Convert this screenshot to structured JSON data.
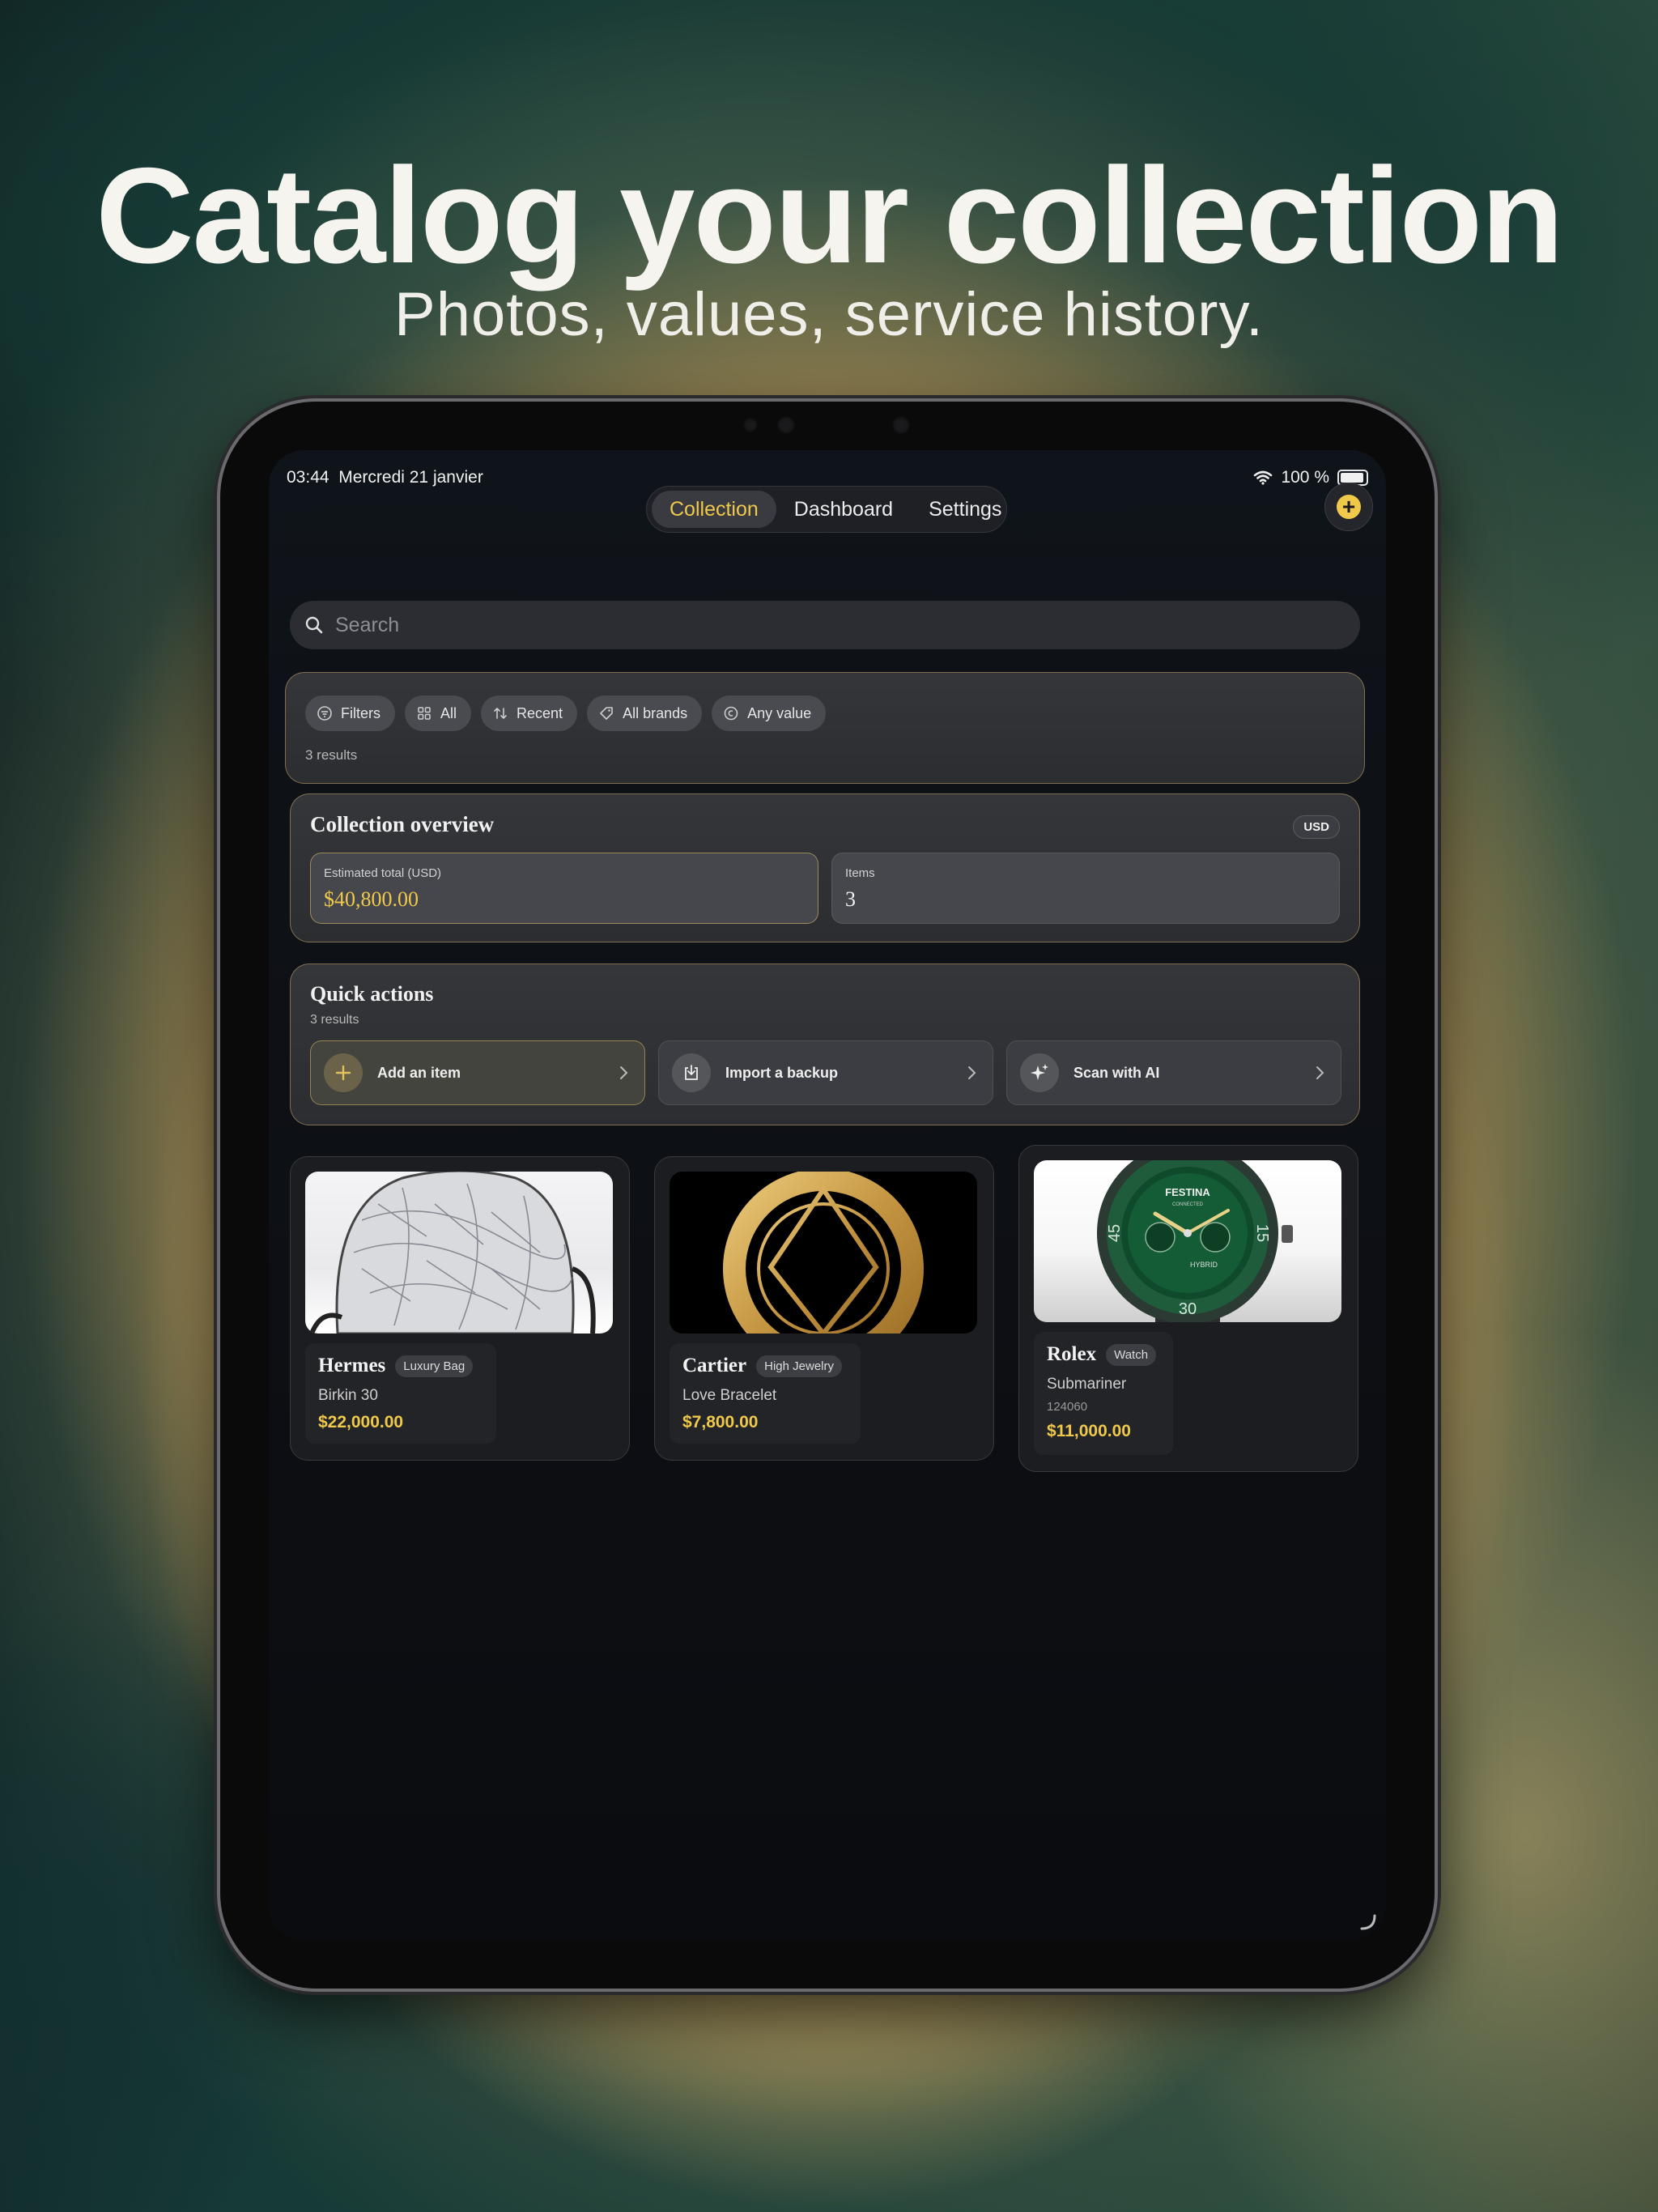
{
  "promo": {
    "headline": "Catalog your collection",
    "subhead": "Photos, values, service history."
  },
  "status_bar": {
    "time": "03:44",
    "date": "Mercredi 21 janvier",
    "battery": "100 %"
  },
  "nav": {
    "tabs": [
      {
        "label": "Collection",
        "active": true
      },
      {
        "label": "Dashboard",
        "active": false
      },
      {
        "label": "Settings",
        "active": false
      }
    ],
    "add_icon": "plus-icon"
  },
  "search": {
    "placeholder": "Search"
  },
  "filters": {
    "chips": [
      {
        "label": "Filters",
        "icon": "filter-icon"
      },
      {
        "label": "All",
        "icon": "grid-icon"
      },
      {
        "label": "Recent",
        "icon": "sort-icon"
      },
      {
        "label": "All brands",
        "icon": "tag-icon"
      },
      {
        "label": "Any value",
        "icon": "coin-icon"
      }
    ],
    "results": "3 results"
  },
  "overview": {
    "title": "Collection overview",
    "currency_badge": "USD",
    "total_label": "Estimated total (USD)",
    "total_value": "$40,800.00",
    "items_label": "Items",
    "items_value": "3"
  },
  "quick_actions": {
    "title": "Quick actions",
    "subtitle": "3 results",
    "actions": [
      {
        "label": "Add an item",
        "icon": "plus-icon"
      },
      {
        "label": "Import a backup",
        "icon": "import-icon"
      },
      {
        "label": "Scan with AI",
        "icon": "sparkle-icon"
      }
    ]
  },
  "items": [
    {
      "brand": "Hermes",
      "category": "Luxury Bag",
      "model": "Birkin 30",
      "reference": "",
      "price": "$22,000.00"
    },
    {
      "brand": "Cartier",
      "category": "High Jewelry",
      "model": "Love Bracelet",
      "reference": "",
      "price": "$7,800.00"
    },
    {
      "brand": "Rolex",
      "category": "Watch",
      "model": "Submariner",
      "reference": "124060",
      "price": "$11,000.00"
    }
  ],
  "watch_dial_text": {
    "logo": "FESTINA",
    "sub": "CONNECTED",
    "line1": "HYBRID",
    "numeral_left": "45",
    "numeral_right": "15",
    "numeral_bottom": "30"
  },
  "colors": {
    "accent": "#f0c94a",
    "panel_border": "#c1a660"
  }
}
